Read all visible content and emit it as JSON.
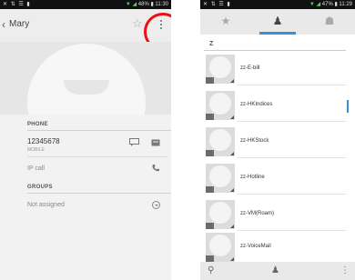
{
  "left_screen": {
    "status_bar": {
      "left": "✕ ⇅ ☰ ▮",
      "right": "48% ▮ 11:30"
    },
    "header": {
      "back_icon": "chevron-left-icon",
      "title": "Mary"
    },
    "sections": {
      "phone": "PHONE",
      "groups": "GROUPS"
    },
    "phone_entry": {
      "number": "12345678",
      "type": "MOBILE"
    },
    "ip_call": "IP call",
    "groups_value": "Not assigned",
    "highlight_color": "#e11111"
  },
  "right_screen": {
    "status_bar": {
      "left": "✕ ⇅ ☰ ▮",
      "right": "47% ▮ 11:29"
    },
    "tabs": [
      {
        "icon": "star-icon",
        "selected": false
      },
      {
        "icon": "person-icon",
        "selected": true
      },
      {
        "icon": "group-icon",
        "selected": false
      }
    ],
    "section_letter": "Z",
    "contacts": [
      "zz-E-bill",
      "zz-HKIndices",
      "zz-HKStock",
      "zz-Hotline",
      "zz-VM(Roam)",
      "zz-VoiceMail"
    ],
    "accent_color": "#3a8fd6"
  }
}
